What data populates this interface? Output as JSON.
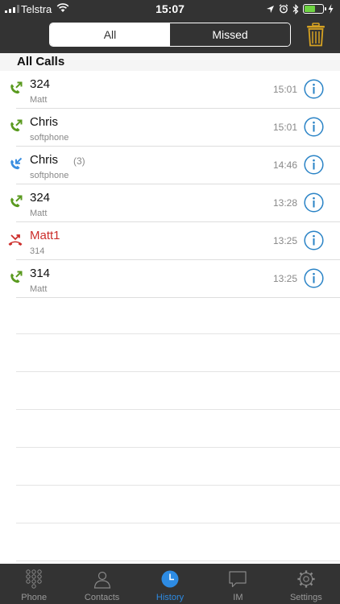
{
  "status_bar": {
    "carrier": "Telstra",
    "time": "15:07",
    "battery_level": 0.6
  },
  "header": {
    "segments": [
      {
        "label": "All",
        "active": true
      },
      {
        "label": "Missed",
        "active": false
      }
    ],
    "trash_icon": "trash-icon"
  },
  "section_title": "All Calls",
  "calls": [
    {
      "name": "324",
      "count": "",
      "sub": "Matt",
      "time": "15:01",
      "type": "outgoing"
    },
    {
      "name": "Chris",
      "count": "",
      "sub": "softphone",
      "time": "15:01",
      "type": "outgoing"
    },
    {
      "name": "Chris",
      "count": "(3)",
      "sub": "softphone",
      "time": "14:46",
      "type": "incoming"
    },
    {
      "name": "324",
      "count": "",
      "sub": "Matt",
      "time": "13:28",
      "type": "outgoing"
    },
    {
      "name": "Matt1",
      "count": "",
      "sub": "314",
      "time": "13:25",
      "type": "missed"
    },
    {
      "name": "314",
      "count": "",
      "sub": "Matt",
      "time": "13:25",
      "type": "outgoing"
    }
  ],
  "tabs": [
    {
      "label": "Phone",
      "icon": "keypad-icon",
      "active": false
    },
    {
      "label": "Contacts",
      "icon": "contact-icon",
      "active": false
    },
    {
      "label": "History",
      "icon": "clock-icon",
      "active": true
    },
    {
      "label": "IM",
      "icon": "chat-bubble-icon",
      "active": false
    },
    {
      "label": "Settings",
      "icon": "gear-icon",
      "active": false
    }
  ],
  "colors": {
    "bar": "#333333",
    "outgoing": "#5a9a1f",
    "incoming": "#3a8ee0",
    "missed": "#cc2e2b",
    "info": "#2a83c6",
    "trash": "#d6a222",
    "tab_active": "#2d8be3"
  }
}
